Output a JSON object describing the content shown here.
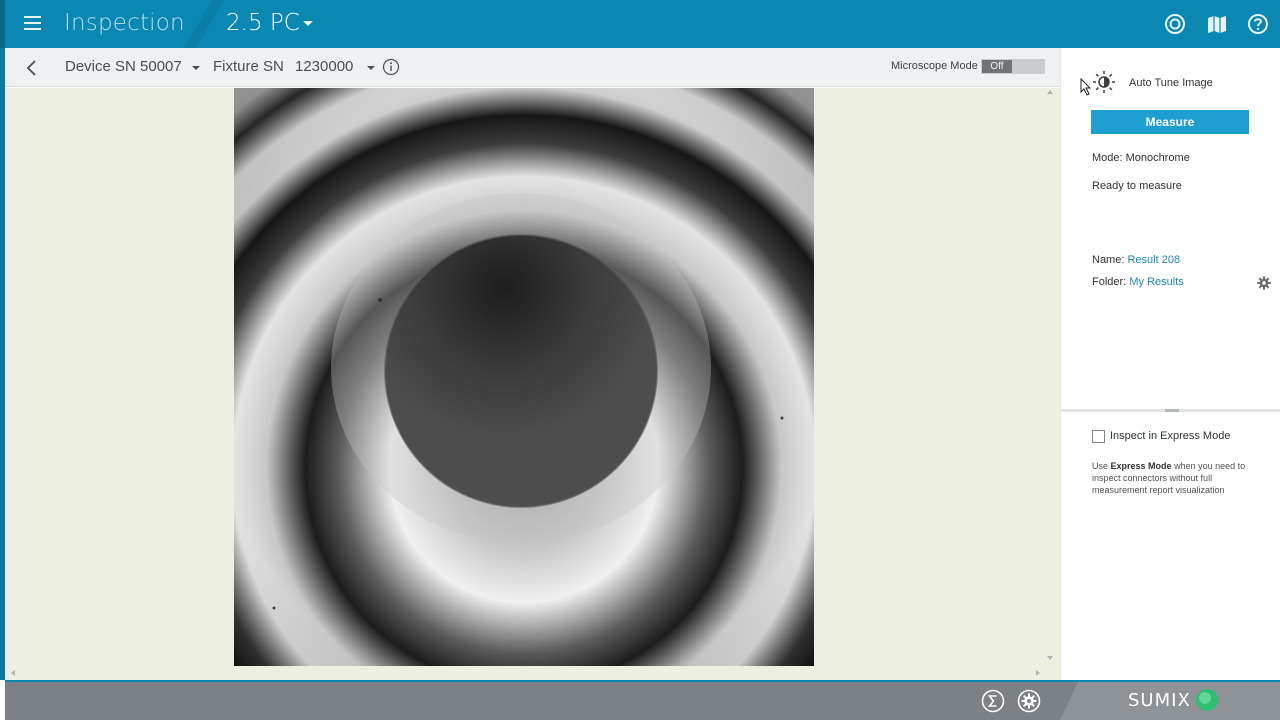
{
  "header": {
    "app_title": "Inspection",
    "profile": "2.5 PC",
    "icons": [
      "target-icon",
      "map-icon",
      "help-icon"
    ]
  },
  "toolbar": {
    "device_label": "Device SN 50007",
    "fixture_label": "Fixture SN",
    "fixture_value": "1230000",
    "microscope_label": "Microscope Mode",
    "microscope_state": "Off"
  },
  "panel": {
    "auto_tune_label": "Auto Tune Image",
    "measure_label": "Measure",
    "mode_text": "Mode: Monochrome",
    "status_text": "Ready to measure",
    "name_label": "Name:",
    "name_value": "Result 208",
    "folder_label": "Folder:",
    "folder_value": "My Results",
    "express_label": "Inspect in Express Mode",
    "express_help_prefix": "Use",
    "express_help_bold": "Express Mode",
    "express_help_suffix": "when you need to inspect connectors without full measurement report visualization",
    "express_checked": false
  },
  "footer": {
    "brand": "SUMIX",
    "icons": [
      "sigma-icon",
      "settings-icon"
    ]
  },
  "colors": {
    "header": "#0b87b3",
    "accent": "#1f9fcf",
    "viewer_bg": "#edefe0",
    "footer": "#7b8184",
    "brand_green": "#2fbf73"
  }
}
